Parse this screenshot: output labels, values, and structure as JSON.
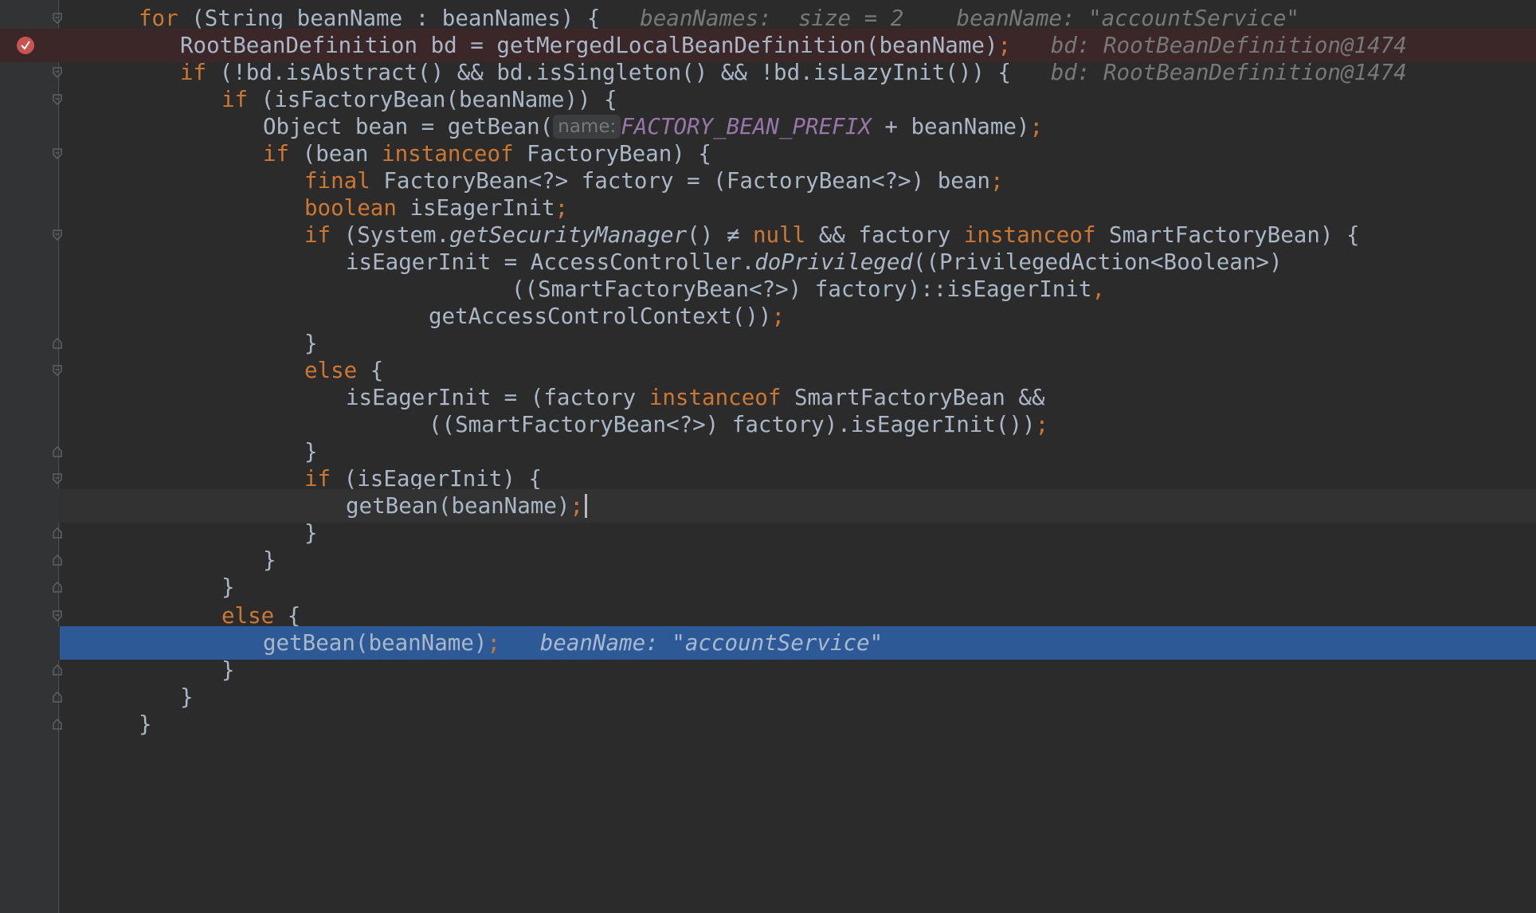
{
  "editor": {
    "top_partial": "···",
    "lines": {
      "l1": {
        "kw_for": "for",
        "a": " (String beanName : beanNames) {",
        "debug": "   beanNames:  size = 2    beanName: \"accountService\""
      },
      "l2": {
        "a": "RootBeanDefinition bd = getMergedLocalBeanDefinition(beanName)",
        "semi": ";",
        "debug": "   bd: RootBeanDefinition@1474"
      },
      "l3": {
        "kw_if": "if",
        "a": " (!bd.isAbstract() && bd.isSingleton() && !bd.isLazyInit()) {",
        "debug": "   bd: RootBeanDefinition@1474"
      },
      "l4": {
        "kw_if": "if",
        "a": " (isFactoryBean(beanName)) {"
      },
      "l5": {
        "a": "Object bean = getBean(",
        "hint": "name:",
        "const": "FACTORY_BEAN_PREFIX",
        "b": " + beanName)",
        "semi": ";"
      },
      "l6": {
        "kw_if": "if",
        "a": " (bean ",
        "kw_instanceof": "instanceof",
        "b": " FactoryBean) {"
      },
      "l7": {
        "kw_final": "final",
        "a": " FactoryBean<?> factory = (FactoryBean<?>) bean",
        "semi": ";"
      },
      "l8": {
        "kw_boolean": "boolean",
        "a": " isEagerInit",
        "semi": ";"
      },
      "l9": {
        "kw_if": "if",
        "a": " (System.",
        "fn": "getSecurityManager",
        "b": "() ≠ ",
        "kw_null": "null",
        "c": " && factory ",
        "kw_instanceof": "instanceof",
        "d": " SmartFactoryBean) {"
      },
      "l10": {
        "a": "isEagerInit = AccessController.",
        "fn": "doPrivileged",
        "b": "((PrivilegedAction<Boolean>)"
      },
      "l11": {
        "a": "((SmartFactoryBean<?>) factory)::isEagerInit",
        "semi": ","
      },
      "l12": {
        "a": "getAccessControlContext())",
        "semi": ";"
      },
      "l13": {
        "a": "}"
      },
      "l14": {
        "kw_else": "else",
        "a": " {"
      },
      "l15": {
        "a": "isEagerInit = (factory ",
        "kw_instanceof": "instanceof",
        "b": " SmartFactoryBean &&"
      },
      "l16": {
        "a": "((SmartFactoryBean<?>) factory).isEagerInit())",
        "semi": ";"
      },
      "l17": {
        "a": "}"
      },
      "l18": {
        "kw_if": "if",
        "a": " (isEagerInit) {"
      },
      "l19": {
        "a": "getBean(beanName)",
        "semi": ";"
      },
      "l20": {
        "a": "}"
      },
      "l21": {
        "a": "}"
      },
      "l22": {
        "a": "}"
      },
      "l23": {
        "kw_else": "else",
        "a": " {"
      },
      "l24": {
        "a": "getBean(beanName)",
        "semi": ";",
        "debug": "   beanName: \"accountService\""
      },
      "l25": {
        "a": "}"
      },
      "l26": {
        "a": "}"
      },
      "l27": {
        "a": "}"
      }
    }
  },
  "colors": {
    "background": "#2b2b2b",
    "keyword": "#cc7832",
    "text": "#a9b7c6",
    "constant": "#9876aa",
    "execution_line": "#2d5a97",
    "breakpoint_line": "#3b2628",
    "breakpoint_marker": "#c75450"
  }
}
